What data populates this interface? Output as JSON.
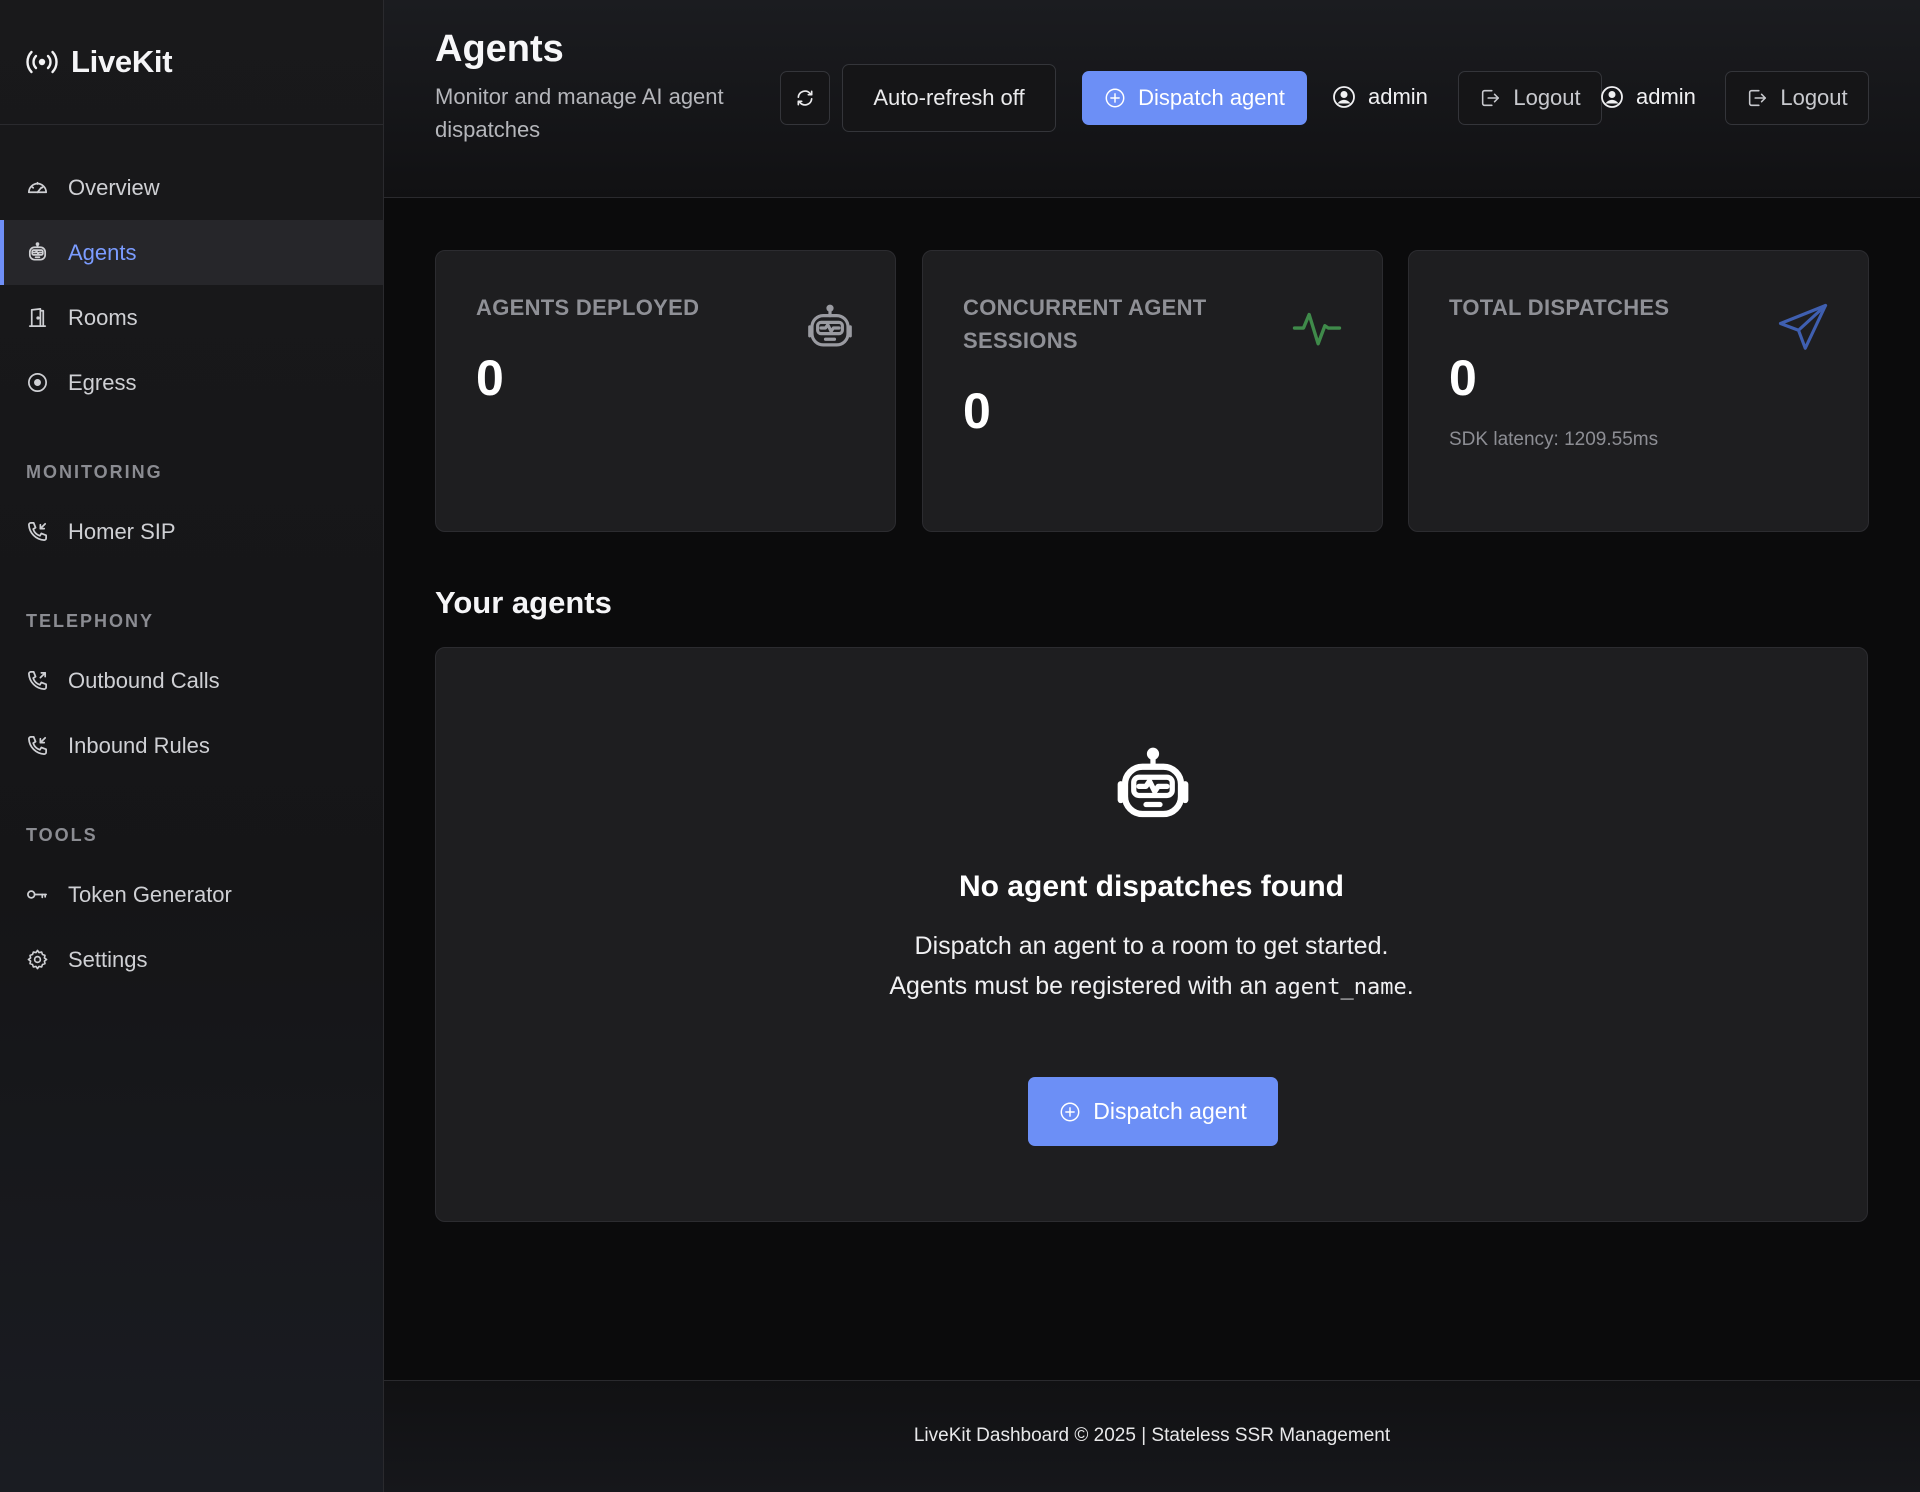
{
  "brand": {
    "name": "LiveKit",
    "icon": "broadcast-icon"
  },
  "sidebar": {
    "items": [
      {
        "label": "Overview",
        "icon": "gauge-icon"
      },
      {
        "label": "Agents",
        "icon": "robot-icon",
        "active": true
      },
      {
        "label": "Rooms",
        "icon": "door-icon"
      },
      {
        "label": "Egress",
        "icon": "record-icon"
      }
    ],
    "sections": [
      {
        "title": "MONITORING",
        "items": [
          {
            "label": "Homer SIP",
            "icon": "phone-incoming-icon"
          }
        ]
      },
      {
        "title": "TELEPHONY",
        "items": [
          {
            "label": "Outbound Calls",
            "icon": "phone-outgoing-icon"
          },
          {
            "label": "Inbound Rules",
            "icon": "phone-incoming-icon"
          }
        ]
      },
      {
        "title": "TOOLS",
        "items": [
          {
            "label": "Token Generator",
            "icon": "key-icon"
          },
          {
            "label": "Settings",
            "icon": "gear-icon"
          }
        ]
      }
    ]
  },
  "header": {
    "title": "Agents",
    "subtitle": "Monitor and manage AI agent dispatches",
    "auto_refresh_label": "Auto-refresh off",
    "dispatch_label": "Dispatch agent",
    "users": [
      {
        "name": "admin",
        "logout_label": "Logout"
      },
      {
        "name": "admin",
        "logout_label": "Logout"
      }
    ]
  },
  "stats": [
    {
      "label": "AGENTS DEPLOYED",
      "value": "0",
      "icon": "robot-icon",
      "icon_color": "#9a9ba1"
    },
    {
      "label": "CONCURRENT AGENT SESSIONS",
      "value": "0",
      "icon": "activity-icon",
      "icon_color": "#3f8a4a"
    },
    {
      "label": "TOTAL DISPATCHES",
      "value": "0",
      "sub": "SDK latency: 1209.55ms",
      "icon": "send-icon",
      "icon_color": "#3f5fb0"
    }
  ],
  "agents_section": {
    "title": "Your agents",
    "empty_title": "No agent dispatches found",
    "empty_line1": "Dispatch an agent to a room to get started.",
    "empty_line2_prefix": "Agents must be registered with an ",
    "empty_line2_code": "agent_name",
    "empty_line2_suffix": ".",
    "dispatch_label": "Dispatch agent"
  },
  "footer": {
    "text": "LiveKit Dashboard © 2025 | Stateless SSR Management"
  },
  "colors": {
    "accent": "#6c8ff6",
    "active_nav_text": "#7b9cff",
    "card_bg": "#1e1e20"
  }
}
